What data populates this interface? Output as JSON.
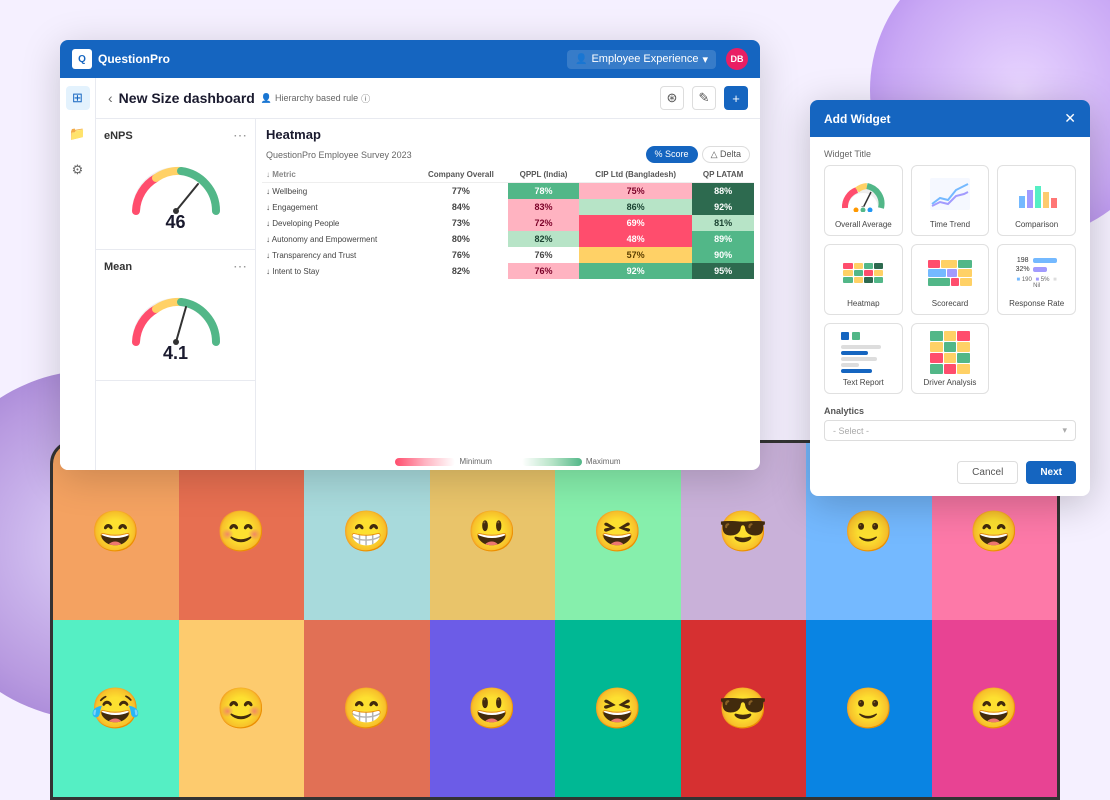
{
  "background": {
    "blob_color_1": "#c9a8f5",
    "blob_color_2": "#9370cc"
  },
  "nav": {
    "logo_text": "QuestionPro",
    "logo_letter": "Q",
    "emp_exp_label": "Employee Experience",
    "avatar_label": "DB",
    "dropdown_arrow": "▾"
  },
  "dashboard": {
    "title": "New Size dashboard",
    "hierarchy_label": "Hierarchy based rule",
    "back_arrow": "‹"
  },
  "header_actions": {
    "filter_icon": "⊛",
    "edit_icon": "✎",
    "add_icon": "+"
  },
  "enps_widget": {
    "title": "eNPS",
    "menu": "⋯",
    "value": "46"
  },
  "mean_widget": {
    "title": "Mean",
    "menu": "⋯",
    "value": "4.1"
  },
  "heatmap": {
    "title": "Heatmap",
    "survey_label": "QuestionPro Employee Survey 2023",
    "tab_score": "% Score",
    "tab_delta": "△ Delta",
    "columns": [
      "Metric",
      "Company Overall",
      "QPPL (India)",
      "CIP Ltd (Bangladesh)",
      "QP LATAM"
    ],
    "rows": [
      {
        "metric": "Wellbeing",
        "company_overall": "77%",
        "qppl_india": "78%",
        "cip_ltd": "75%",
        "qp_latam": "88%",
        "colors": [
          "neutral",
          "green",
          "pink-light",
          "green-dark"
        ]
      },
      {
        "metric": "Engagement",
        "company_overall": "84%",
        "qppl_india": "83%",
        "cip_ltd": "86%",
        "qp_latam": "92%",
        "colors": [
          "neutral",
          "pink-light",
          "green-light",
          "green-dark"
        ]
      },
      {
        "metric": "Developing People",
        "company_overall": "73%",
        "qppl_india": "72%",
        "cip_ltd": "69%",
        "qp_latam": "81%",
        "colors": [
          "neutral",
          "pink-light",
          "pink",
          "green-light"
        ]
      },
      {
        "metric": "Autonomy and Empowerment",
        "company_overall": "80%",
        "qppl_india": "82%",
        "cip_ltd": "48%",
        "qp_latam": "89%",
        "colors": [
          "neutral",
          "green-light",
          "pink",
          "green"
        ]
      },
      {
        "metric": "Transparency and Trust",
        "company_overall": "76%",
        "qppl_india": "76%",
        "cip_ltd": "57%",
        "qp_latam": "90%",
        "colors": [
          "neutral",
          "neutral",
          "yellow",
          "green"
        ]
      },
      {
        "metric": "Intent to Stay",
        "company_overall": "82%",
        "qppl_india": "76%",
        "cip_ltd": "92%",
        "qp_latam": "95%",
        "colors": [
          "neutral",
          "pink-light",
          "green",
          "green-dark"
        ]
      }
    ],
    "legend_min": "Minimum",
    "legend_max": "Maximum"
  },
  "add_widget_modal": {
    "title": "Add Widget",
    "close": "✕",
    "widget_title_label": "Widget Title",
    "widgets": [
      {
        "id": "overall-average",
        "label": "Overall Average"
      },
      {
        "id": "time-trend",
        "label": "Time Trend"
      },
      {
        "id": "comparison",
        "label": "Comparison"
      },
      {
        "id": "heatmap",
        "label": "Heatmap"
      },
      {
        "id": "scorecard",
        "label": "Scorecard"
      },
      {
        "id": "response-rate",
        "label": "Response Rate"
      },
      {
        "id": "text-report",
        "label": "Text Report"
      },
      {
        "id": "driver-analysis",
        "label": "Driver Analysis"
      }
    ],
    "analytics_label": "Analytics",
    "analytics_placeholder": "- Select -",
    "cancel_label": "Cancel",
    "next_label": "Next"
  },
  "photos": [
    {
      "bg": "#f4a261",
      "emoji": "😄"
    },
    {
      "bg": "#e8b4b8",
      "emoji": "😊"
    },
    {
      "bg": "#a8dadc",
      "emoji": "😁"
    },
    {
      "bg": "#e9c46a",
      "emoji": "😃"
    },
    {
      "bg": "#86efac",
      "emoji": "😆"
    },
    {
      "bg": "#c9b1d9",
      "emoji": "😎"
    },
    {
      "bg": "#74b9ff",
      "emoji": "🙂"
    },
    {
      "bg": "#fd79a8",
      "emoji": "😄"
    },
    {
      "bg": "#55efc4",
      "emoji": "😂"
    },
    {
      "bg": "#fdcb6e",
      "emoji": "😊"
    },
    {
      "bg": "#e17055",
      "emoji": "😁"
    },
    {
      "bg": "#6c5ce7",
      "emoji": "😃"
    },
    {
      "bg": "#00b894",
      "emoji": "😆"
    },
    {
      "bg": "#d63031",
      "emoji": "😎"
    },
    {
      "bg": "#0984e3",
      "emoji": "🙂"
    },
    {
      "bg": "#e84393",
      "emoji": "😄"
    }
  ]
}
